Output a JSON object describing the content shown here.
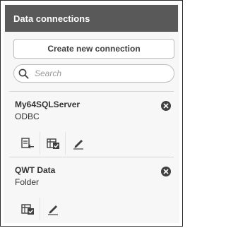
{
  "header": {
    "title": "Data connections"
  },
  "toolbar": {
    "create_label": "Create new connection",
    "search_placeholder": "Search"
  },
  "connections": [
    {
      "name": "My64SQLServer",
      "type": "ODBC",
      "actions": [
        "insert-script-icon",
        "select-data-icon",
        "edit-icon"
      ]
    },
    {
      "name": "QWT Data",
      "type": "Folder",
      "actions": [
        "select-data-icon",
        "edit-icon"
      ]
    }
  ],
  "colors": {
    "header_bg": "#595959",
    "panel_bg": "#f7f7f7",
    "icon": "#404040"
  }
}
